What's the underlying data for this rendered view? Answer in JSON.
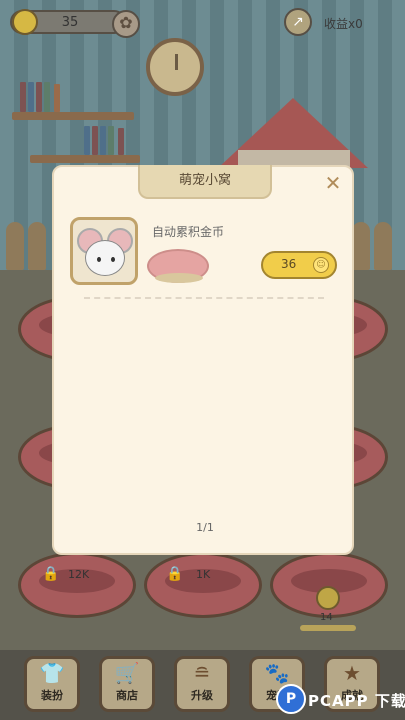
{
  "topbar": {
    "coin_count": "35",
    "earnings_label": "收益x0"
  },
  "modal": {
    "title": "萌宠小窝",
    "close_symbol": "✕",
    "item": {
      "description": "自动累积金币",
      "price": "36"
    },
    "page_indicator": "1/1"
  },
  "slots": [
    {
      "cost": "12K"
    },
    {
      "cost": "1K"
    }
  ],
  "mini_slot_level": "14",
  "bottom_nav": [
    {
      "label": "装扮",
      "icon": "shirt-icon"
    },
    {
      "label": "商店",
      "icon": "cart-icon"
    },
    {
      "label": "升级",
      "icon": "levels-icon"
    },
    {
      "label": "宠物",
      "icon": "paw-icon"
    },
    {
      "label": "成就",
      "icon": "trophy-icon"
    }
  ],
  "watermark": {
    "logo": "P",
    "text": "PCAPP 下载"
  },
  "colors": {
    "modal_bg": "#fcf4e4",
    "button_yellow": "#f1cd4a",
    "tab_bg": "#e6d8b2"
  }
}
